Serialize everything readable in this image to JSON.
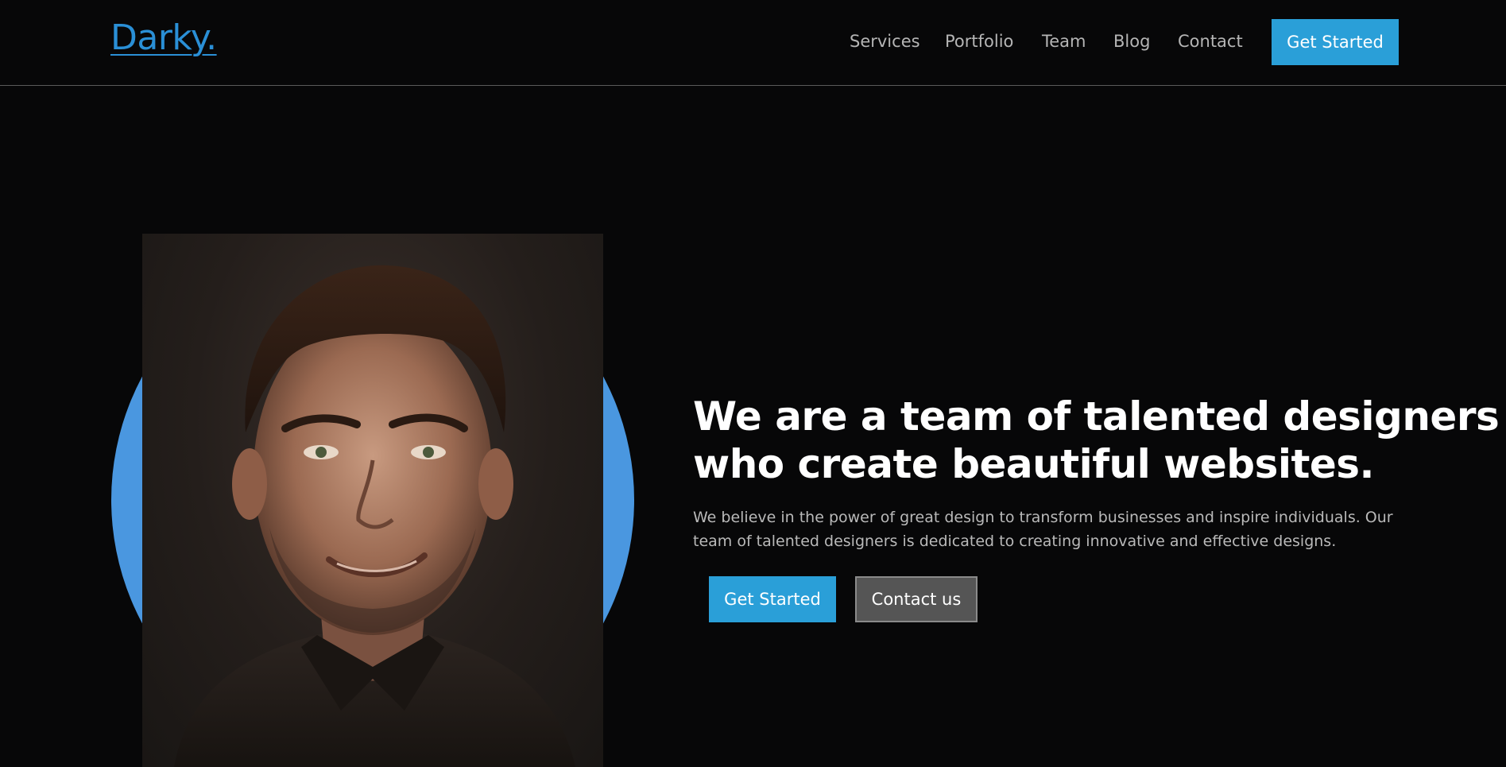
{
  "header": {
    "logo": "Darky.",
    "nav": [
      "Services",
      "Portfolio",
      "Team",
      "Blog",
      "Contact"
    ],
    "cta_label": "Get Started"
  },
  "hero": {
    "headline_lines": [
      "We are a team of talented designers",
      "who create beautiful websites."
    ],
    "description_lines": [
      "We believe in the power of great design to transform businesses and inspire individuals. Our",
      "team of talented designers is dedicated to creating innovative and effective designs."
    ],
    "primary_button": "Get Started",
    "secondary_button": "Contact us",
    "portrait_icon": "person-portrait-photo"
  },
  "colors": {
    "background": "#070708",
    "accent": "#2a9fd8",
    "logo": "#2a8fd6",
    "circle": "#4a97e0",
    "secondary_button": "#555555"
  }
}
